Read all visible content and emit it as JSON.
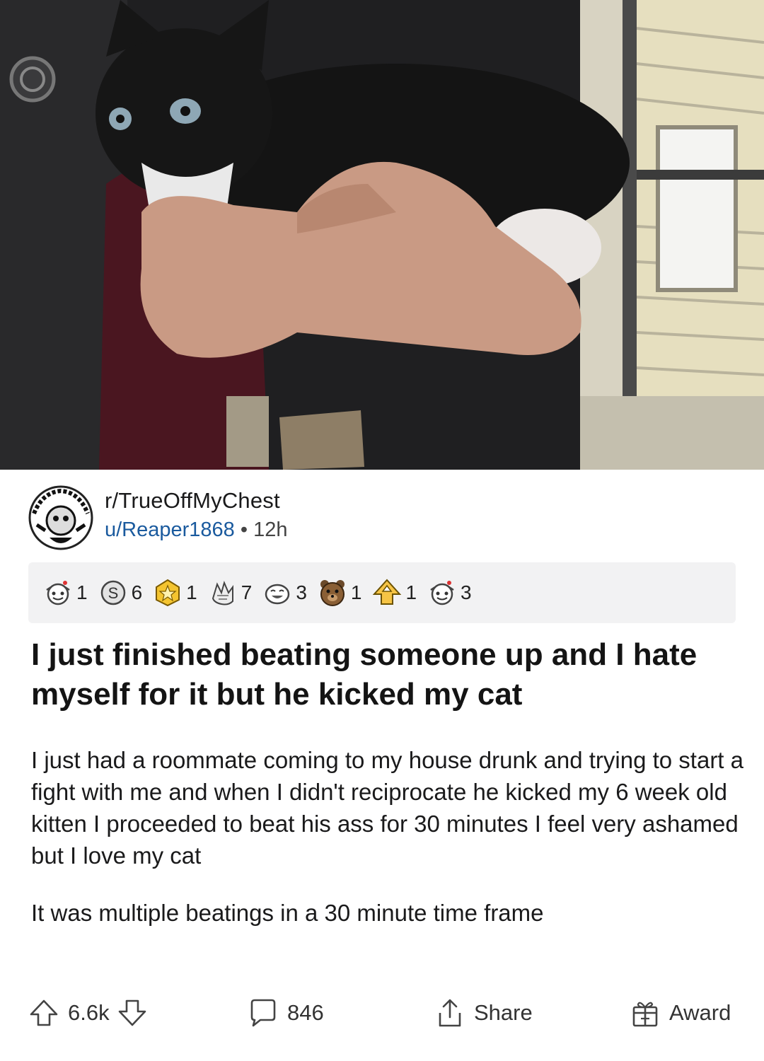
{
  "post": {
    "subreddit": "r/TrueOffMyChest",
    "author": "u/Reaper1868",
    "separator": "•",
    "age": "12h",
    "title": "I just finished beating someone up and I hate myself for it but he kicked my cat",
    "body": [
      "I just had a roommate coming to my house drunk and trying to start a fight with me and when I didn't reciprocate he kicked my 6 week old kitten I proceeded to beat his ass for 30 minutes I feel very ashamed but I love my cat",
      "It was multiple beatings in a 30 minute time frame"
    ]
  },
  "awards": [
    {
      "icon": "wholesome-award-icon",
      "count": "1"
    },
    {
      "icon": "silver-coin-award-icon",
      "count": "6"
    },
    {
      "icon": "gold-star-award-icon",
      "count": "1"
    },
    {
      "icon": "hand-award-icon",
      "count": "7"
    },
    {
      "icon": "laughing-face-award-icon",
      "count": "3"
    },
    {
      "icon": "bear-award-icon",
      "count": "1"
    },
    {
      "icon": "arrow-up-award-icon",
      "count": "1"
    },
    {
      "icon": "wholesome-award-icon",
      "count": "3"
    }
  ],
  "actions": {
    "upvotes": "6.6k",
    "comments": "846",
    "share_label": "Share",
    "award_label": "Award"
  },
  "colors": {
    "author_blue": "#1a5a9e",
    "award_bar_bg": "#f2f2f3",
    "text": "#1a1a1b"
  }
}
